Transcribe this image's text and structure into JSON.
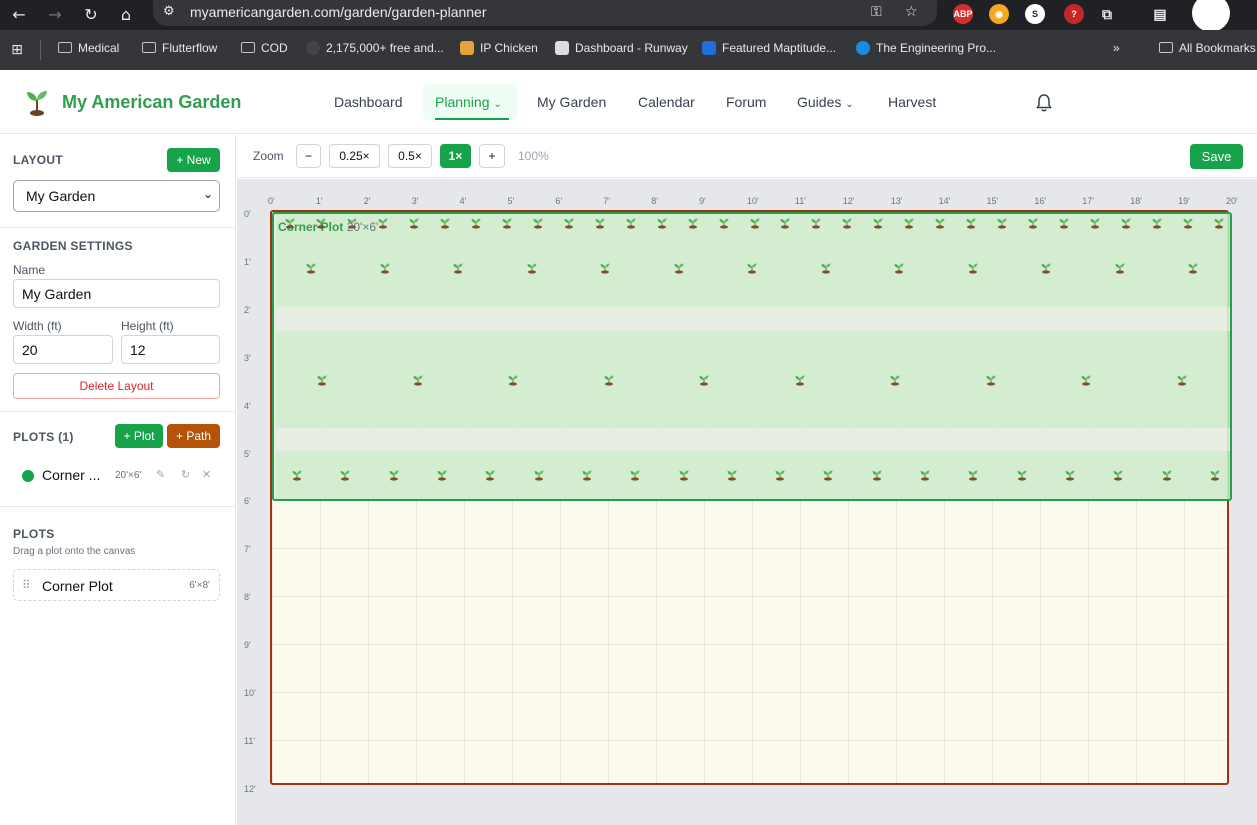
{
  "browser": {
    "url": "myamericangarden.com/garden/garden-planner",
    "bookmarks": [
      {
        "label": "Medical",
        "type": "folder"
      },
      {
        "label": "Flutterflow",
        "type": "folder"
      },
      {
        "label": "COD",
        "type": "folder"
      },
      {
        "label": "2,175,000+ free and...",
        "type": "site"
      },
      {
        "label": "IP Chicken",
        "type": "site"
      },
      {
        "label": "Dashboard - Runway",
        "type": "site"
      },
      {
        "label": "Featured Maptitude...",
        "type": "site"
      },
      {
        "label": "The Engineering Pro...",
        "type": "site"
      }
    ],
    "all_bookmarks": "All Bookmarks",
    "ext_badge": "ABP"
  },
  "app": {
    "brand": "My American Garden",
    "nav": [
      {
        "label": "Dashboard"
      },
      {
        "label": "Planning",
        "dropdown": true,
        "active": true
      },
      {
        "label": "My Garden"
      },
      {
        "label": "Calendar"
      },
      {
        "label": "Forum"
      },
      {
        "label": "Guides",
        "dropdown": true
      },
      {
        "label": "Harvest"
      }
    ]
  },
  "sidebar": {
    "layout_label": "LAYOUT",
    "new_button": "+ New",
    "layout_select": "My Garden",
    "settings_label": "GARDEN SETTINGS",
    "name_label": "Name",
    "name_value": "My Garden",
    "width_label": "Width (ft)",
    "width_value": "20",
    "height_label": "Height (ft)",
    "height_value": "12",
    "delete_button": "Delete Layout",
    "plots_count_label": "PLOTS (1)",
    "add_plot_button": "+ Plot",
    "add_path_button": "+ Path",
    "plot_entry": {
      "name": "Corner ...",
      "size": "20'×6'"
    },
    "plots_label": "PLOTS",
    "drag_hint": "Drag a plot onto the canvas",
    "template": {
      "name": "Corner Plot",
      "size": "6'×8'"
    }
  },
  "toolbar": {
    "zoom_label": "Zoom",
    "minus": "−",
    "z025": "0.25×",
    "z05": "0.5×",
    "z1": "1×",
    "plus": "+",
    "zoom_percent": "100%",
    "save": "Save"
  },
  "canvas": {
    "garden_width_ft": 20,
    "garden_height_ft": 12,
    "x_ticks": [
      "0'",
      "1'",
      "2'",
      "3'",
      "4'",
      "5'",
      "6'",
      "7'",
      "8'",
      "9'",
      "10'",
      "11'",
      "12'",
      "13'",
      "14'",
      "15'",
      "16'",
      "17'",
      "18'",
      "19'",
      "20'"
    ],
    "y_ticks": [
      "0'",
      "1'",
      "2'",
      "3'",
      "4'",
      "5'",
      "6'",
      "7'",
      "8'",
      "9'",
      "10'",
      "11'",
      "12'"
    ],
    "plot": {
      "name": "Corner Plot",
      "dims": "20'×6'",
      "rows": [
        {
          "plants_top": 31,
          "plants_bottom": 13
        },
        {
          "plants": 10
        },
        {
          "plants": 20
        }
      ]
    }
  },
  "colors": {
    "brand_green": "#2f9e4f",
    "primary": "#16a34a",
    "path_brown": "#b45309",
    "garden_border": "#9a3412"
  }
}
